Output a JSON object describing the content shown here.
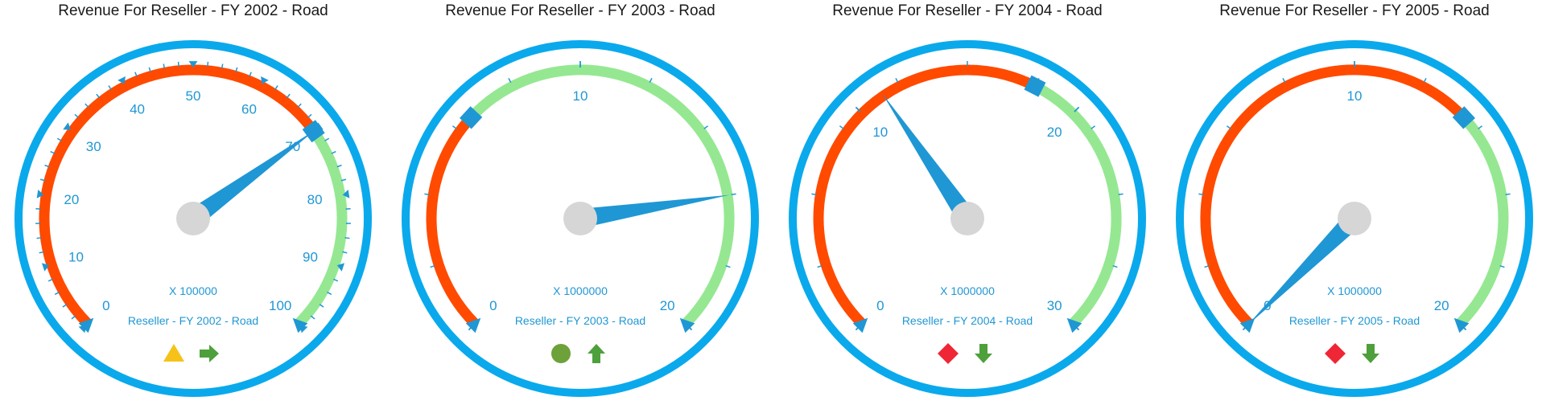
{
  "colors": {
    "frame": "#0aa9ec",
    "accent": "#1f97d4",
    "red_range": "#ff4a00",
    "green_range": "#95e891",
    "hub": "#d6d6d6",
    "kpi_warning": "#f6c21a",
    "kpi_good": "#6da13a",
    "kpi_bad": "#ef2636",
    "trend": "#4ea03c"
  },
  "chart_data": [
    {
      "type": "gauge",
      "title": "Revenue For Reseller - FY 2002 - Road",
      "range": [
        0,
        100
      ],
      "tick_labels": [
        "0",
        "10",
        "20",
        "30",
        "40",
        "50",
        "60",
        "70",
        "80",
        "90",
        "100"
      ],
      "major_step": 10,
      "minor_step": 2,
      "tick_style": "triangles",
      "value": 70,
      "target": 70,
      "red_range": [
        0,
        70
      ],
      "green_range": [
        70,
        100
      ],
      "multiplier": "X 100000",
      "caption": "Reseller - FY 2002 - Road",
      "status_icon": "warning-triangle-icon",
      "status_color": "kpi_warning",
      "trend_icon": "arrow-right-icon"
    },
    {
      "type": "gauge",
      "title": "Revenue For Reseller - FY 2003 - Road",
      "range": [
        0,
        20
      ],
      "tick_labels": [
        "0",
        "10",
        "20"
      ],
      "major_step": 10,
      "minor_step": 2,
      "tick_style": "lines",
      "value": 16,
      "target": 6.5,
      "red_range": [
        0,
        6.5
      ],
      "green_range": [
        6.5,
        20
      ],
      "multiplier": "X 1000000",
      "caption": "Reseller - FY 2003 - Road",
      "status_icon": "circle-status-icon",
      "status_color": "kpi_good",
      "trend_icon": "arrow-up-icon"
    },
    {
      "type": "gauge",
      "title": "Revenue For Reseller - FY 2004 - Road",
      "range": [
        0,
        30
      ],
      "tick_labels": [
        "0",
        "10",
        "20",
        "30"
      ],
      "major_step": 10,
      "minor_step": 3,
      "tick_style": "lines",
      "value": 11.2,
      "target": 18,
      "red_range": [
        0,
        18
      ],
      "green_range": [
        18,
        30
      ],
      "multiplier": "X 1000000",
      "caption": "Reseller - FY 2004 - Road",
      "status_icon": "diamond-status-icon",
      "status_color": "kpi_bad",
      "trend_icon": "arrow-down-icon"
    },
    {
      "type": "gauge",
      "title": "Revenue For Reseller - FY 2005 - Road",
      "range": [
        0,
        20
      ],
      "tick_labels": [
        "0",
        "10",
        "20"
      ],
      "major_step": 10,
      "minor_step": 2,
      "tick_style": "lines",
      "value": 0,
      "target": 13.5,
      "red_range": [
        0,
        13.5
      ],
      "green_range": [
        13.5,
        20
      ],
      "multiplier": "X 1000000",
      "caption": "Reseller - FY 2005 - Road",
      "status_icon": "diamond-status-icon",
      "status_color": "kpi_bad",
      "trend_icon": "arrow-down-icon"
    }
  ]
}
